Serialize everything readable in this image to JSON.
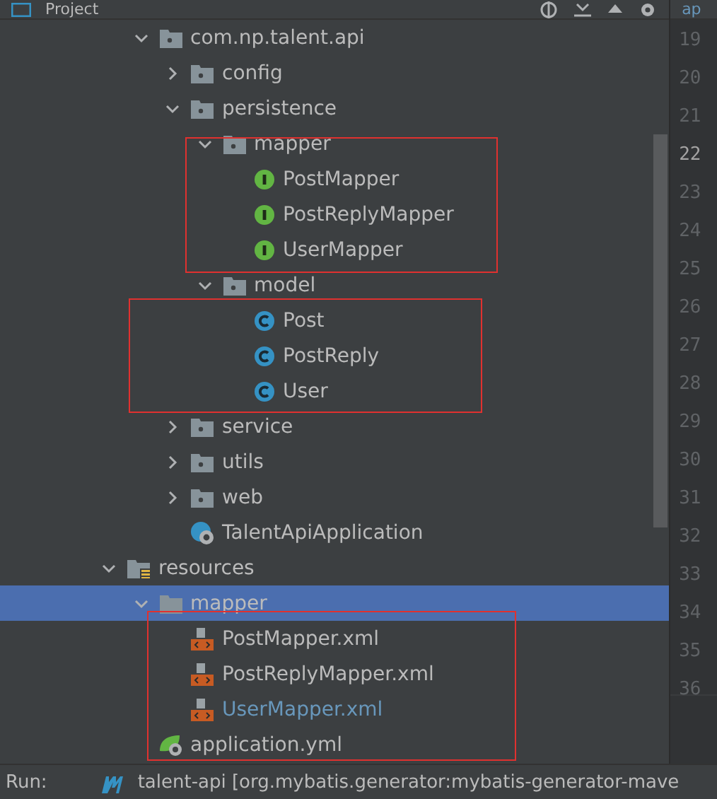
{
  "panel_header": {
    "title": "Project"
  },
  "editor_tab": {
    "label": "ap"
  },
  "tree": [
    {
      "label": "com.np.talent.api",
      "kind": "package",
      "expanded": true,
      "selected": false,
      "children": [
        {
          "label": "config",
          "kind": "package",
          "expanded": false,
          "selected": false
        },
        {
          "label": "persistence",
          "kind": "package",
          "expanded": true,
          "selected": false,
          "children": [
            {
              "label": "mapper",
              "kind": "package",
              "expanded": true,
              "selected": false,
              "children": [
                {
                  "label": "PostMapper",
                  "kind": "interface",
                  "selected": false
                },
                {
                  "label": "PostReplyMapper",
                  "kind": "interface",
                  "selected": false
                },
                {
                  "label": "UserMapper",
                  "kind": "interface",
                  "selected": false
                }
              ]
            },
            {
              "label": "model",
              "kind": "package",
              "expanded": true,
              "selected": false,
              "children": [
                {
                  "label": "Post",
                  "kind": "class",
                  "selected": false
                },
                {
                  "label": "PostReply",
                  "kind": "class",
                  "selected": false
                },
                {
                  "label": "User",
                  "kind": "class",
                  "selected": false
                }
              ]
            }
          ]
        },
        {
          "label": "service",
          "kind": "package",
          "expanded": false,
          "selected": false
        },
        {
          "label": "utils",
          "kind": "package",
          "expanded": false,
          "selected": false
        },
        {
          "label": "web",
          "kind": "package",
          "expanded": false,
          "selected": false
        },
        {
          "label": "TalentApiApplication",
          "kind": "spring-class",
          "selected": false
        }
      ]
    },
    {
      "label": "resources",
      "kind": "resources",
      "expanded": true,
      "selected": false,
      "children": [
        {
          "label": "mapper",
          "kind": "folder",
          "expanded": true,
          "selected": true,
          "children": [
            {
              "label": "PostMapper.xml",
              "kind": "xml",
              "selected": false,
              "modified": false
            },
            {
              "label": "PostReplyMapper.xml",
              "kind": "xml",
              "selected": false,
              "modified": false
            },
            {
              "label": "UserMapper.xml",
              "kind": "xml",
              "selected": false,
              "modified": true
            }
          ]
        },
        {
          "label": "application.yml",
          "kind": "yml",
          "selected": false
        }
      ]
    }
  ],
  "line_numbers": [
    {
      "text": "19",
      "current": false
    },
    {
      "text": "20",
      "current": false
    },
    {
      "text": "21",
      "current": false
    },
    {
      "text": "22",
      "current": true
    },
    {
      "text": "23",
      "current": false
    },
    {
      "text": "24",
      "current": false
    },
    {
      "text": "25",
      "current": false
    },
    {
      "text": "26",
      "current": false
    },
    {
      "text": "27",
      "current": false
    },
    {
      "text": "28",
      "current": false
    },
    {
      "text": "29",
      "current": false
    },
    {
      "text": "30",
      "current": false
    },
    {
      "text": "31",
      "current": false
    },
    {
      "text": "32",
      "current": false
    },
    {
      "text": "33",
      "current": false
    },
    {
      "text": "34",
      "current": false
    },
    {
      "text": "35",
      "current": false
    },
    {
      "text": "36",
      "current": false
    }
  ],
  "run_bar": {
    "label": "Run:",
    "config": "talent-api [org.mybatis.generator:mybatis-generator-mave"
  }
}
